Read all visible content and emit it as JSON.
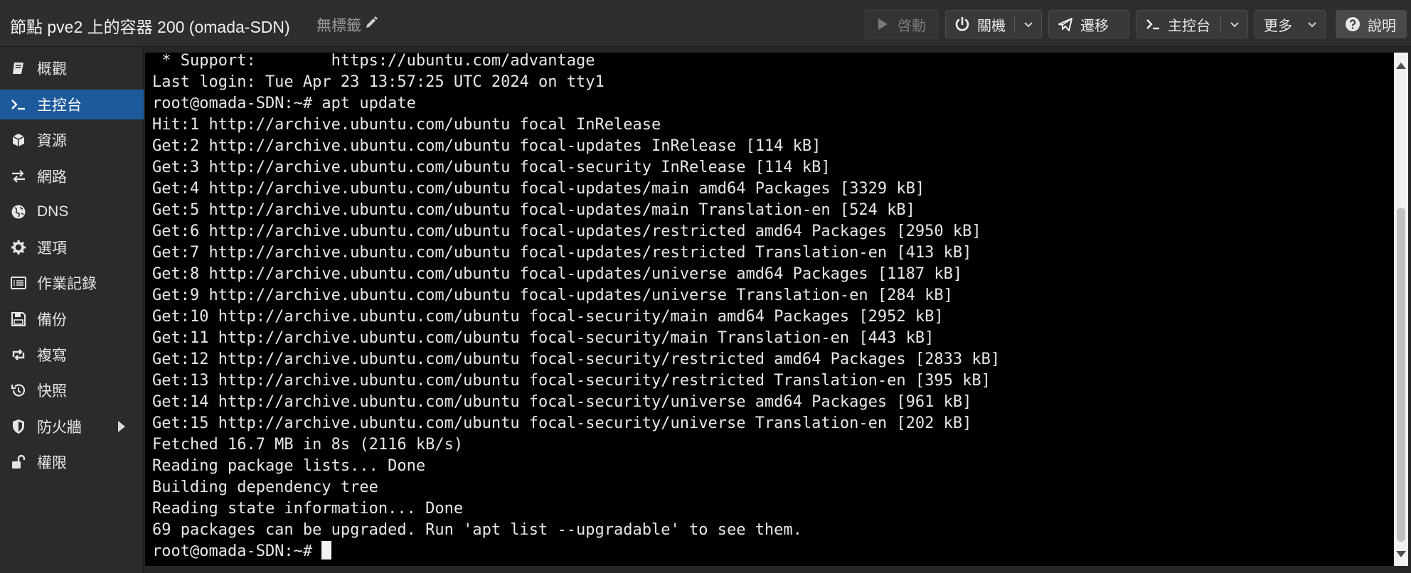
{
  "header": {
    "title": "節點 pve2 上的容器 200 (omada-SDN)",
    "tags_label": "無標籤",
    "buttons": {
      "start": "啓動",
      "shutdown": "關機",
      "migrate": "遷移",
      "console": "主控台",
      "more": "更多",
      "help": "說明"
    }
  },
  "sidebar": {
    "items": [
      {
        "label": "概觀",
        "icon": "book-icon"
      },
      {
        "label": "主控台",
        "icon": "terminal-icon"
      },
      {
        "label": "資源",
        "icon": "cube-icon"
      },
      {
        "label": "網路",
        "icon": "exchange-icon"
      },
      {
        "label": "DNS",
        "icon": "globe-icon"
      },
      {
        "label": "選項",
        "icon": "gear-icon"
      },
      {
        "label": "作業記錄",
        "icon": "list-icon"
      },
      {
        "label": "備份",
        "icon": "floppy-icon"
      },
      {
        "label": "複寫",
        "icon": "retweet-icon"
      },
      {
        "label": "快照",
        "icon": "history-icon"
      },
      {
        "label": "防火牆",
        "icon": "shield-icon"
      },
      {
        "label": "權限",
        "icon": "unlock-icon"
      }
    ],
    "active_index": 1
  },
  "terminal": {
    "lines": [
      " * Support:        https://ubuntu.com/advantage",
      "Last login: Tue Apr 23 13:57:25 UTC 2024 on tty1",
      "root@omada-SDN:~# apt update",
      "Hit:1 http://archive.ubuntu.com/ubuntu focal InRelease",
      "Get:2 http://archive.ubuntu.com/ubuntu focal-updates InRelease [114 kB]",
      "Get:3 http://archive.ubuntu.com/ubuntu focal-security InRelease [114 kB]",
      "Get:4 http://archive.ubuntu.com/ubuntu focal-updates/main amd64 Packages [3329 kB]",
      "Get:5 http://archive.ubuntu.com/ubuntu focal-updates/main Translation-en [524 kB]",
      "Get:6 http://archive.ubuntu.com/ubuntu focal-updates/restricted amd64 Packages [2950 kB]",
      "Get:7 http://archive.ubuntu.com/ubuntu focal-updates/restricted Translation-en [413 kB]",
      "Get:8 http://archive.ubuntu.com/ubuntu focal-updates/universe amd64 Packages [1187 kB]",
      "Get:9 http://archive.ubuntu.com/ubuntu focal-updates/universe Translation-en [284 kB]",
      "Get:10 http://archive.ubuntu.com/ubuntu focal-security/main amd64 Packages [2952 kB]",
      "Get:11 http://archive.ubuntu.com/ubuntu focal-security/main Translation-en [443 kB]",
      "Get:12 http://archive.ubuntu.com/ubuntu focal-security/restricted amd64 Packages [2833 kB]",
      "Get:13 http://archive.ubuntu.com/ubuntu focal-security/restricted Translation-en [395 kB]",
      "Get:14 http://archive.ubuntu.com/ubuntu focal-security/universe amd64 Packages [961 kB]",
      "Get:15 http://archive.ubuntu.com/ubuntu focal-security/universe Translation-en [202 kB]",
      "Fetched 16.7 MB in 8s (2116 kB/s)",
      "Reading package lists... Done",
      "Building dependency tree",
      "Reading state information... Done",
      "69 packages can be upgraded. Run 'apt list --upgradable' to see them."
    ],
    "prompt": "root@omada-SDN:~# "
  },
  "colors": {
    "accent": "#1d5a9b",
    "terminal_bg": "#000000",
    "terminal_fg": "#e8e8e8",
    "header_bg": "#2e2e2e",
    "sidebar_bg": "#2b2b2b"
  }
}
